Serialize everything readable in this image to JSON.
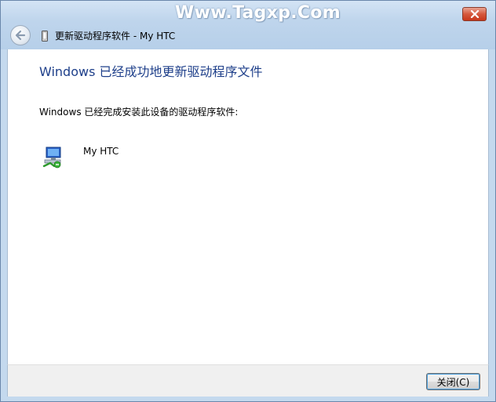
{
  "watermark": "Www.Tagxp.Com",
  "window": {
    "title": "更新驱动程序软件 - My HTC"
  },
  "content": {
    "heading": "Windows 已经成功地更新驱动程序文件",
    "message": "Windows 已经完成安装此设备的驱动程序软件:",
    "device_name": "My HTC"
  },
  "footer": {
    "close_label": "关闭(C)"
  },
  "icons": {
    "window_close": "close-icon",
    "back": "back-arrow-icon",
    "title": "device-icon",
    "device": "network-device-icon"
  },
  "colors": {
    "heading": "#1e3f8a",
    "titlebar": "#bfd5ec",
    "close_button": "#d5583c"
  }
}
